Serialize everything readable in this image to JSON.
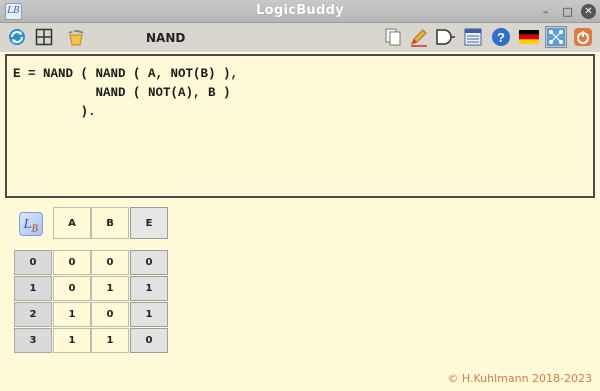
{
  "window": {
    "title": "LogicBuddy",
    "app_icon_text": "LB",
    "controls": {
      "minimize": "–",
      "maximize": "□",
      "close": "✕"
    }
  },
  "toolbar": {
    "gate_label": "NAND",
    "left_icons": [
      "refresh-icon",
      "grid-icon",
      "clear-icon"
    ],
    "right_icons": [
      "copy-icon",
      "edit-icon",
      "gate-icon",
      "table-view-icon",
      "help-icon",
      "german-flag-icon",
      "network-icon",
      "power-icon"
    ]
  },
  "editor": {
    "lines": [
      "E = NAND ( NAND ( A, NOT(B) ),",
      "           NAND ( NOT(A), B )",
      "         )."
    ]
  },
  "truth_table": {
    "inputs": [
      "A",
      "B"
    ],
    "output": "E",
    "rows": [
      {
        "index": "0",
        "A": "0",
        "B": "0",
        "E": "0"
      },
      {
        "index": "1",
        "A": "0",
        "B": "1",
        "E": "1"
      },
      {
        "index": "2",
        "A": "1",
        "B": "0",
        "E": "1"
      },
      {
        "index": "3",
        "A": "1",
        "B": "1",
        "E": "0"
      }
    ]
  },
  "footer": {
    "copyright": "© H.Kuhlmann 2018-2023"
  },
  "colors": {
    "background": "#fffbd9",
    "titlebar": "#bdbdbd",
    "toolbar": "#d9d6cf",
    "copyright": "#d97a4a"
  }
}
